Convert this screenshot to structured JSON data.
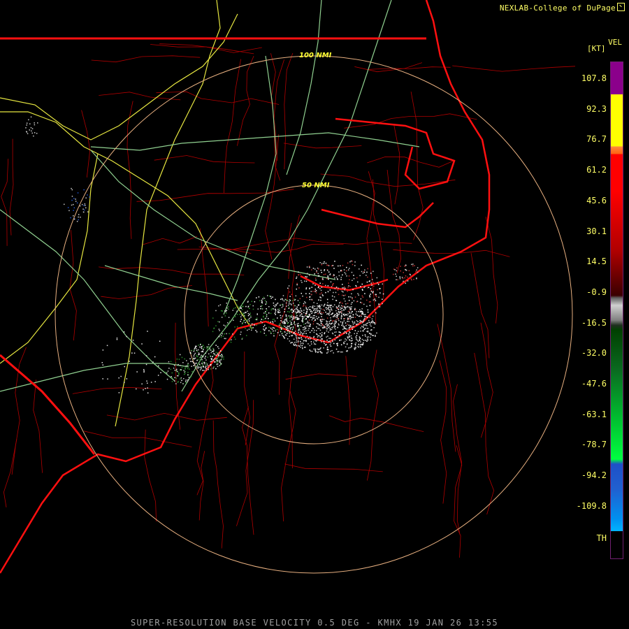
{
  "header": {
    "credit": "NEXLAB-College of DuPage"
  },
  "legend": {
    "product": "VEL",
    "unit": "[KT]",
    "labels": [
      "107.8",
      "92.3",
      "76.7",
      "61.2",
      "45.6",
      "30.1",
      "14.5",
      "-0.9",
      "-16.5",
      "-32.0",
      "-47.6",
      "-63.1",
      "-78.7",
      "-94.2",
      "-109.8",
      "TH"
    ],
    "colors": {
      "purple": "#8b008b",
      "yellow": "#ffff00",
      "orange": "#ff8c3c",
      "red": "#ff0000",
      "dark_red": "#3a0000",
      "gray": "#d0d0d0",
      "dark_green": "#004000",
      "green": "#00ff40",
      "blue": "#1e50c8",
      "cyan": "#00b4ff"
    }
  },
  "rings": {
    "inner_label": "50 NMI",
    "outer_label": "100 NMI"
  },
  "footer": {
    "caption": "SUPER-RESOLUTION BASE VELOCITY 0.5 DEG - KMHX 19 JAN 26 13:55"
  },
  "map_colors": {
    "state_border": "#ff1010",
    "county_line": "#b00000",
    "road_primary": "#e6e640",
    "road_secondary": "#90d090",
    "ring": "#e8b080",
    "echo_gray": "#c8c8c8",
    "echo_green": "#2a8a2a",
    "echo_red": "#c03030"
  }
}
